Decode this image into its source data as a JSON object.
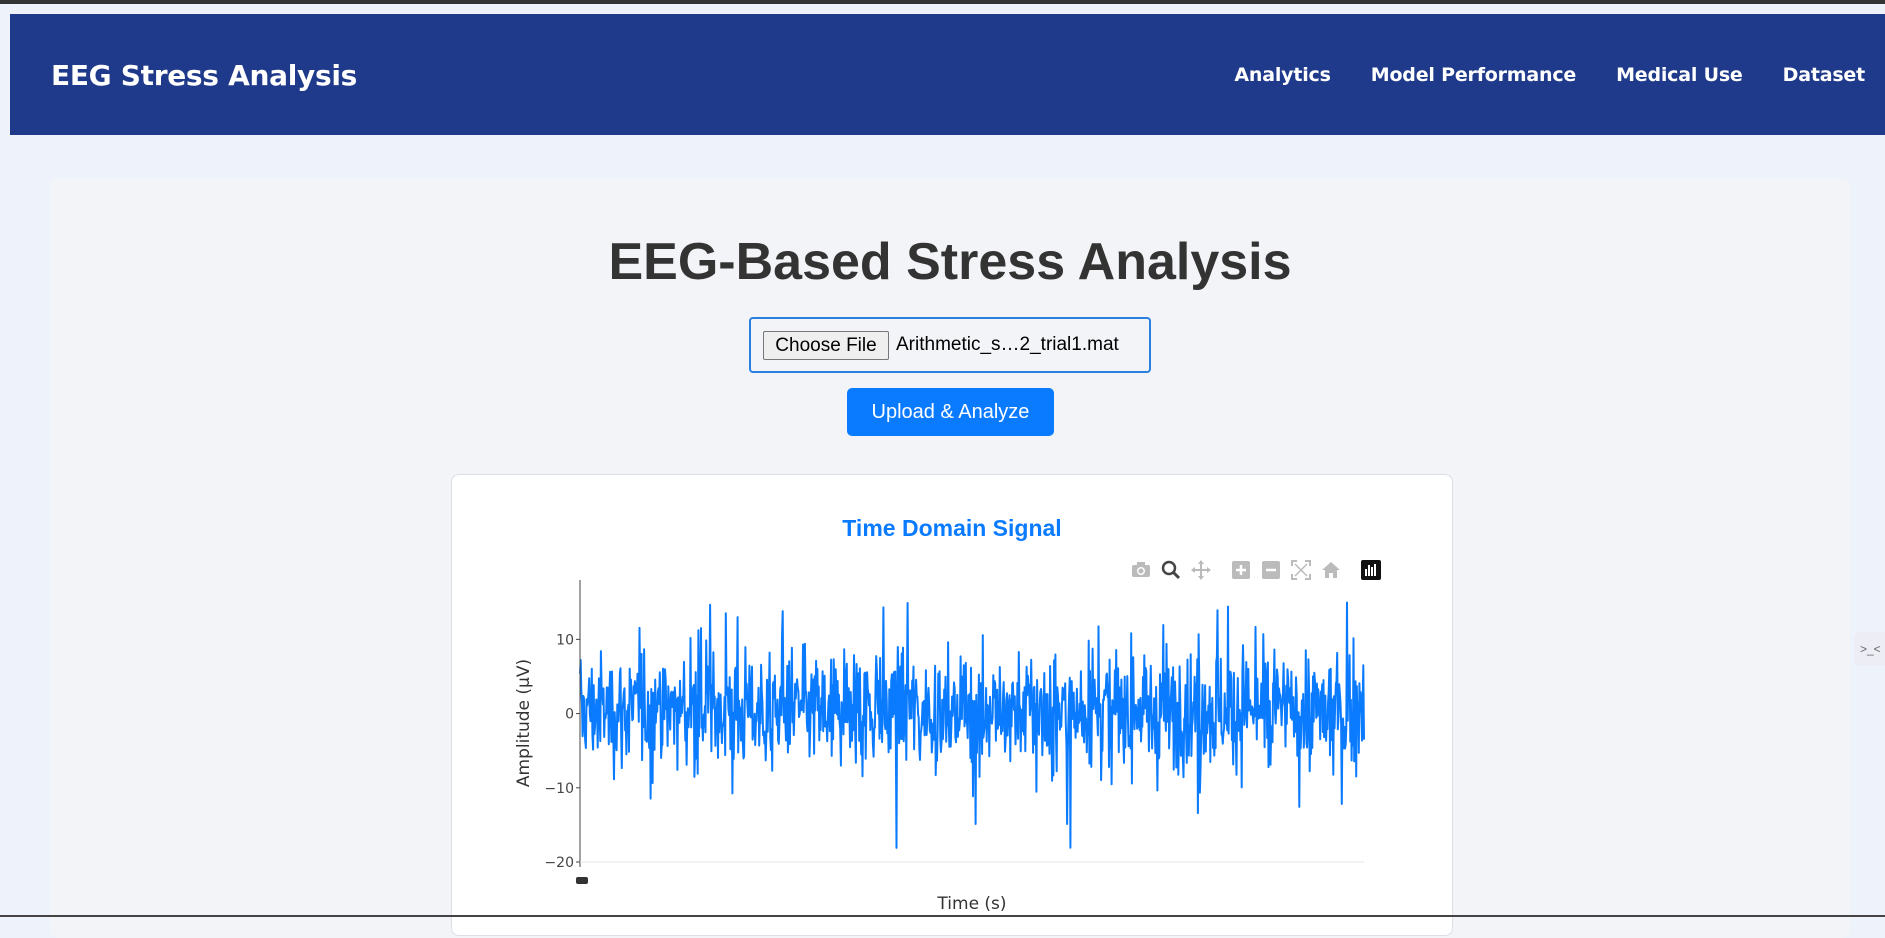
{
  "navbar": {
    "brand": "EEG Stress Analysis",
    "links": [
      "Analytics",
      "Model Performance",
      "Medical Use",
      "Dataset"
    ]
  },
  "main": {
    "title": "EEG-Based Stress Analysis",
    "file_input": {
      "button_label": "Choose File",
      "file_name": "Arithmetic_s…2_trial1.mat"
    },
    "upload_label": "Upload & Analyze"
  },
  "chart_data": {
    "type": "line",
    "title": "Time Domain Signal",
    "xlabel": "Time (s)",
    "ylabel": "Amplitude (µV)",
    "ylim": [
      -20,
      18
    ],
    "yticks": [
      10,
      0,
      -10,
      -20
    ],
    "ytick_labels": [
      "10",
      "0",
      "−10",
      "−20"
    ],
    "series": [
      {
        "color": "#0a7bff",
        "samples": 1200,
        "description_range": [
          -19,
          17
        ]
      }
    ],
    "grid": false
  },
  "modebar": {
    "icons": [
      "camera-icon",
      "zoom-icon",
      "pan-icon",
      "zoom-in-icon",
      "zoom-out-icon",
      "autoscale-icon",
      "reset-axes-icon",
      "plotly-logo-icon"
    ]
  },
  "colors": {
    "navbar": "#1f3a8a",
    "accent": "#0a7bff",
    "page_bg": "#eef2fb"
  }
}
